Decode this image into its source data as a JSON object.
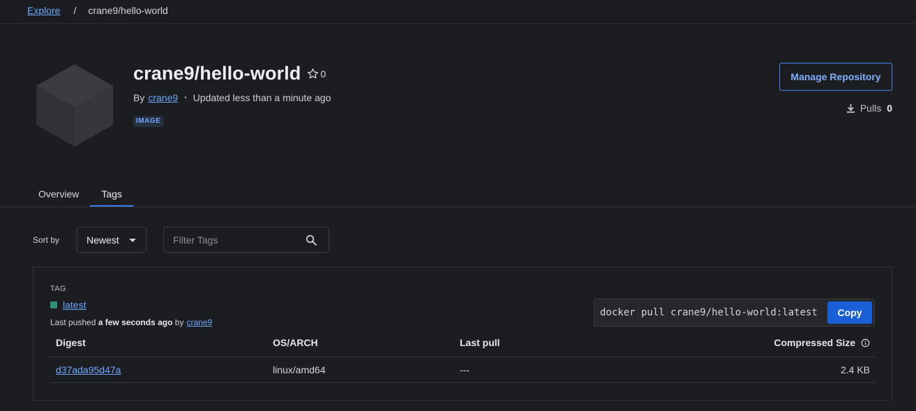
{
  "breadcrumb": {
    "root": "Explore",
    "separator": "/",
    "current": "crane9/hello-world"
  },
  "repo": {
    "title": "crane9/hello-world",
    "stars": "0",
    "by_prefix": "By",
    "owner": "crane9",
    "updated": "Updated less than a minute ago",
    "badge": "IMAGE"
  },
  "actions": {
    "manage_label": "Manage Repository",
    "pulls_label": "Pulls",
    "pulls_count": "0"
  },
  "tabs": [
    {
      "label": "Overview"
    },
    {
      "label": "Tags"
    }
  ],
  "toolbar": {
    "sort_label": "Sort by",
    "sort_value": "Newest",
    "filter_placeholder": "Filter Tags"
  },
  "tag_card": {
    "heading": "TAG",
    "tag_name": "latest",
    "pushed_prefix": "Last pushed",
    "pushed_time": "a few seconds ago",
    "pushed_by": "by",
    "pushed_user": "crane9",
    "pull_command": "docker pull crane9/hello-world:latest",
    "copy_label": "Copy",
    "columns": {
      "digest": "Digest",
      "os_arch": "OS/ARCH",
      "last_pull": "Last pull",
      "size": "Compressed Size"
    },
    "rows": [
      {
        "digest": "d37ada95d47a",
        "os_arch": "linux/amd64",
        "last_pull": "---",
        "size": "2.4 KB"
      }
    ]
  },
  "colors": {
    "accent": "#3b7cf0",
    "link": "#6ea7ff",
    "tag_status": "#2f8f79",
    "background": "#1c1d20"
  }
}
